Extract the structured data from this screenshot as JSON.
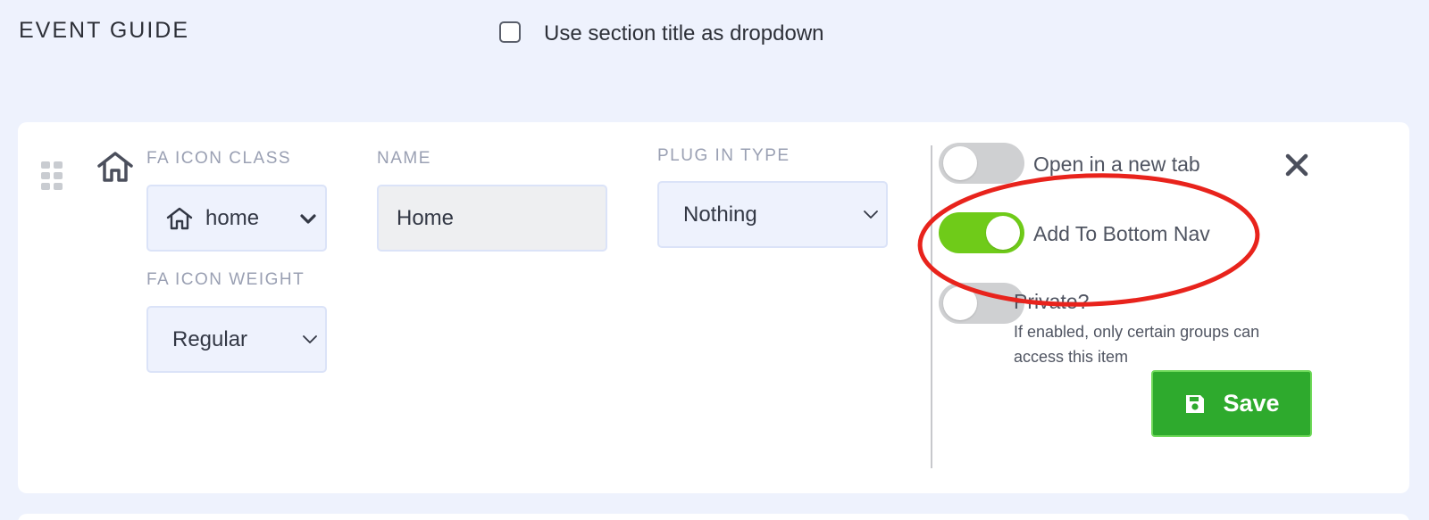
{
  "header": {
    "section_title": "EVENT GUIDE",
    "dropdown_checkbox_label": "Use section title as dropdown",
    "dropdown_checkbox_checked": false
  },
  "item": {
    "fa_icon_class": {
      "label": "FA ICON CLASS",
      "value": "home",
      "icon": "home-icon"
    },
    "fa_icon_weight": {
      "label": "FA ICON WEIGHT",
      "value": "Regular"
    },
    "name": {
      "label": "NAME",
      "value": "Home"
    },
    "plugin_type": {
      "label": "PLUG IN TYPE",
      "value": "Nothing"
    },
    "toggles": {
      "open_new_tab": {
        "label": "Open in a new tab",
        "on": false
      },
      "bottom_nav": {
        "label": "Add To Bottom Nav",
        "on": true
      },
      "private": {
        "label": "Private?",
        "on": false,
        "help": "If enabled, only certain groups can access this item"
      }
    },
    "save_label": "Save"
  },
  "colors": {
    "page_bg": "#eef2fd",
    "toggle_on": "#6fcb19",
    "toggle_off": "#cfd0d2",
    "save_button": "#2eaa2d",
    "annotation": "#e8231c"
  }
}
